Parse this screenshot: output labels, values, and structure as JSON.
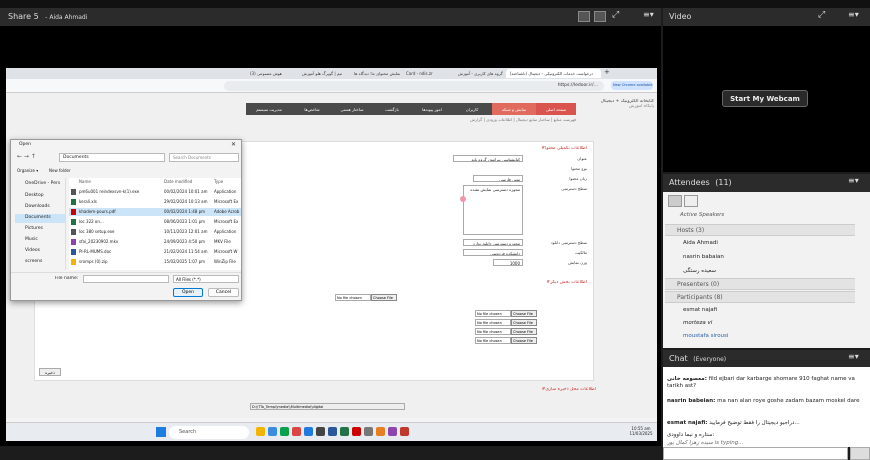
{
  "app": {
    "share_title": "Share 5",
    "presenter": "- Aida Ahmadi",
    "video_title": "Video",
    "attendees_title": "Attendees",
    "attendees_count": "(11)",
    "chat_title": "Chat",
    "chat_scope": "(Everyone)"
  },
  "video": {
    "start_webcam": "Start My Webcam"
  },
  "attendees": {
    "active_speakers": "Active Speakers",
    "hosts_label": "Hosts (3)",
    "hosts": [
      "Aida Ahmadi",
      "nasrin babaian",
      "سعیده رستگی"
    ],
    "presenters_label": "Presenters (0)",
    "participants_label": "Participants (8)",
    "participants": [
      "esmat najafi",
      "morteza vi",
      "moustafa sirousi"
    ]
  },
  "chat": {
    "messages": [
      {
        "sender": "معصومه خانی:",
        "text": "fild ejbari dar karbarge shomare 910 faghat name va tarikh ast?"
      },
      {
        "sender": "nasrin babeian:",
        "text": "ma nan alan roye goshe zadam bazam moskel dare"
      },
      {
        "sender": "esmat najafi:",
        "text": "دراجیو دیجیتال را فقط توضیح فرمایید..."
      },
      {
        "sender": "",
        "text": "ستاره و نیما داوودی:"
      },
      {
        "sender": "",
        "text": "سیده زهرا کمال پور is typing..."
      }
    ],
    "input_placeholder": ""
  },
  "browser": {
    "tabs": [
      "(3) هوش مصنوعی",
      "تیم | گوپرگ هلو آموزش",
      "نمایش محتوای ما: دیدگاه ها",
      "Card - ndis.zr",
      "گروه های کاربری - آموزش",
      "درخواست خدمات الکترونیکی - دیجیتال (ناشناخته)"
    ],
    "url": "https://ledoor.ir/...",
    "side_notice": "New Chrome available",
    "site_name": "کتابخانه الکترونیک + دیجیتال",
    "site_sub": "پایگاه آموزش",
    "nav": [
      "صفحه اصلی",
      "نمایش و شبکه",
      "کاربران",
      "امور پیوندها",
      "بازگشت",
      "ساختار هستی",
      "شاخص‌ها",
      "مدیریت سیستم"
    ],
    "breadcrumb": "فهرست منابع | ساختار منابع دیجیتال | اطلاعات ورودی | گزارش",
    "section1": "#اطلاعات تکمیلی محتوا",
    "field_title_label": "عنوان",
    "field_title_value": "کتابشناسی بیرامون گروه پایه",
    "field_type_label": "نوع محتوا",
    "field_lang_label": "زبان محتوا",
    "field_lang_value": "متنی فارسی",
    "field_access_label": "سطح دسترسی",
    "field_access_value": "مجوزه دسترسی نمایش نشده",
    "field_download_label": "سطح دسترسی دانلود",
    "field_download_value": "مجوزه دسترسی دانلود ندارد",
    "field_owner_label": "مالکیت",
    "field_owner_value": "دانشکده فردوسی",
    "field_weight_label": "وزن نمایش",
    "field_weight_value": "1000",
    "section2": "#اطلاعات بخش دیگر",
    "file_button": "Choose File",
    "file_none": "No file chosen",
    "section3": "#اطلاعات محل ذخیره سازی",
    "storage_path": "D:\\\\TTo_Temp\\\\media\\\\Multimedia\\\\digital",
    "save_button": "ذخیره"
  },
  "dialog": {
    "title": "Open",
    "path": "Documents",
    "search_placeholder": "Search Documents",
    "organize": "Organize ▾",
    "new_folder": "New folder",
    "side_items": [
      "OneDrive - Pers",
      "Desktop",
      "Downloads",
      "Documents",
      "Pictures",
      "Music",
      "Videos",
      "screens"
    ],
    "columns": [
      "Name",
      "Date modified",
      "Type"
    ],
    "files": [
      {
        "name": "pm6u001 reindexsvn-k(1).exe",
        "date": "00/02/2024 10:01 am",
        "type": "Application"
      },
      {
        "name": "kerali.xls",
        "date": "29/02/2024 10:13 am",
        "type": "Microsoft Ex"
      },
      {
        "name": "khadem-pours.pdf",
        "date": "00/02/2024 1:48 pm",
        "type": "Adobe Acrob"
      },
      {
        "name": "loc 322 on...",
        "date": "08/06/2023 1:01 pm",
        "type": "Microsoft Ex"
      },
      {
        "name": "loc 380 setup.exe",
        "date": "10/11/2023 12:01 am",
        "type": "Application"
      },
      {
        "name": "sfai_20230902.mkv",
        "date": "24/09/2023 4:50 pm",
        "type": "MKV File"
      },
      {
        "name": "PI-RL-MUMS.doc",
        "date": "21/02/2024 11:54 am",
        "type": "Microsoft W"
      },
      {
        "name": "sromps (0).zip",
        "date": "15/02/2025 1:07 pm",
        "type": "WinZip File"
      }
    ],
    "filename_label": "File name:",
    "filetype": "All Files (*.*)",
    "open_button": "Open",
    "cancel_button": "Cancel"
  },
  "taskbar": {
    "search": "Search",
    "time": "10:55 am",
    "date": "11/03/2025"
  }
}
